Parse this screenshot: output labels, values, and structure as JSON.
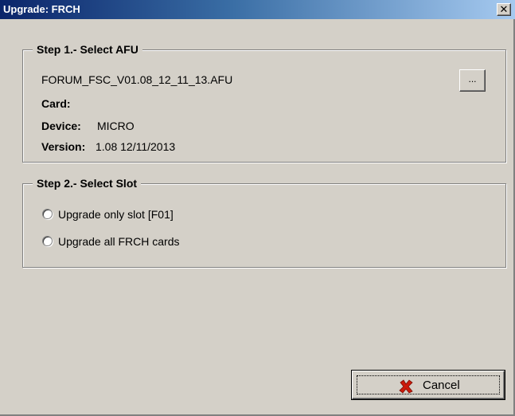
{
  "window": {
    "title": "Upgrade: FRCH",
    "close_glyph": "✕"
  },
  "step1": {
    "legend": "Step 1.- Select AFU",
    "filename": "FORUM_FSC_V01.08_12_11_13.AFU",
    "browse_label": "...",
    "card_label": "Card:",
    "card_value": "",
    "device_label": "Device:",
    "device_value": "MICRO",
    "version_label": "Version:",
    "version_value": "1.08 12/11/2013"
  },
  "step2": {
    "legend": "Step 2.- Select Slot",
    "options": [
      {
        "label": "Upgrade only slot [F01]",
        "selected": false
      },
      {
        "label": "Upgrade all FRCH cards",
        "selected": false
      }
    ]
  },
  "buttons": {
    "cancel_label": "Cancel",
    "cancel_icon": "red-x-icon"
  },
  "colors": {
    "dialog_bg": "#d4d0c8",
    "title_start": "#0a246a",
    "title_end": "#a6caf0",
    "cancel_icon": "#cc1a0a"
  }
}
